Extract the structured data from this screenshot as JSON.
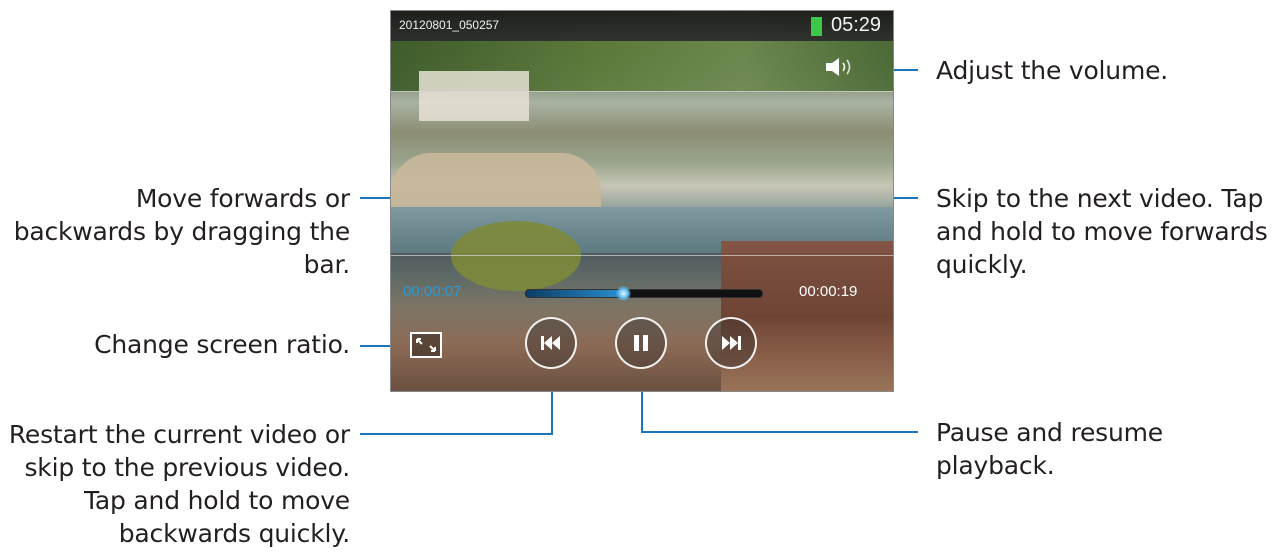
{
  "player": {
    "filename": "20120801_050257",
    "clock": "05:29",
    "elapsed": "00:00:07",
    "remaining": "00:00:19",
    "progress_fraction": 0.41,
    "battery_color": "#3ad04a",
    "accent_color": "#2a9bd6"
  },
  "callouts": {
    "volume": "Adjust the volume.",
    "seek": [
      "Move forwards or",
      "backwards by dragging the",
      "bar."
    ],
    "next": [
      "Skip to the next video. Tap",
      "and hold to move forwards",
      "quickly."
    ],
    "ratio": "Change screen ratio.",
    "previous": [
      "Restart the current video or",
      "skip to the previous video.",
      "Tap and hold to move",
      "backwards quickly."
    ],
    "pause": [
      "Pause and resume",
      "playback."
    ]
  },
  "icons": {
    "volume": "speaker-icon",
    "ratio": "screen-ratio-icon",
    "previous": "rewind-icon",
    "pause": "pause-icon",
    "next": "fast-forward-icon",
    "battery": "battery-icon"
  },
  "leader_color": "#1c75bc"
}
